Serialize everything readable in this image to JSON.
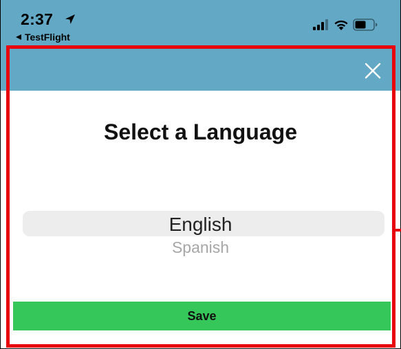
{
  "status_bar": {
    "time": "2:37",
    "back_app": "TestFlight",
    "icons": [
      "location-arrow-icon",
      "signal-icon",
      "wifi-icon",
      "battery-icon"
    ]
  },
  "header": {
    "close_icon": "close-icon"
  },
  "main": {
    "title": "Select a Language",
    "picker": {
      "selected": "English",
      "options": [
        "English",
        "Spanish"
      ]
    },
    "save_label": "Save"
  },
  "colors": {
    "header_bg": "#63a9c6",
    "save_button_bg": "#35c759",
    "picker_highlight": "#ededed",
    "annotation": "#e8000b"
  }
}
